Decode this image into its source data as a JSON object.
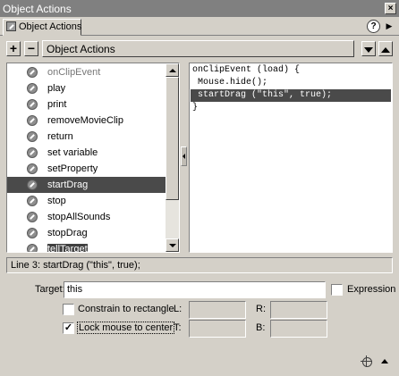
{
  "window": {
    "title": "Object Actions",
    "close_glyph": "×"
  },
  "tab": {
    "label": "Object Actions",
    "icon": "action-arrow-icon"
  },
  "header_buttons": {
    "help": "?",
    "menu": "▶"
  },
  "toolbar": {
    "add": "+",
    "remove": "−",
    "panel_title": "Object Actions"
  },
  "action_list": {
    "items": [
      {
        "label": "onClipEvent",
        "state": "dimmed"
      },
      {
        "label": "play",
        "state": "normal"
      },
      {
        "label": "print",
        "state": "normal"
      },
      {
        "label": "removeMovieClip",
        "state": "normal"
      },
      {
        "label": "return",
        "state": "normal"
      },
      {
        "label": "set variable",
        "state": "normal"
      },
      {
        "label": "setProperty",
        "state": "normal"
      },
      {
        "label": "startDrag",
        "state": "selected"
      },
      {
        "label": "stop",
        "state": "normal"
      },
      {
        "label": "stopAllSounds",
        "state": "normal"
      },
      {
        "label": "stopDrag",
        "state": "normal"
      },
      {
        "label": "tellTarget",
        "state": "partial"
      }
    ]
  },
  "code": {
    "lines": [
      {
        "text": "onClipEvent (load) {",
        "indent": 0,
        "selected": false
      },
      {
        "text": "Mouse.hide();",
        "indent": 1,
        "selected": false
      },
      {
        "text": "startDrag (\"this\", true);",
        "indent": 1,
        "selected": true
      },
      {
        "text": "}",
        "indent": 0,
        "selected": false
      }
    ]
  },
  "status": {
    "text": "Line 3: startDrag (\"this\", true);"
  },
  "params": {
    "target_label": "Target:",
    "target_value": "this",
    "expression_label": "Expression",
    "expression_checked": false,
    "constrain_label": "Constrain to rectangle",
    "constrain_checked": false,
    "lock_label": "Lock mouse to center",
    "lock_checked": true,
    "l_label": "L:",
    "r_label": "R:",
    "t_label": "T:",
    "b_label": "B:",
    "l_value": "",
    "r_value": "",
    "t_value": "",
    "b_value": ""
  },
  "footer": {
    "target_icon": "target-path-icon",
    "collapse_icon": "collapse-triangle-icon"
  },
  "colors": {
    "face": "#d4d0c8",
    "title_bar": "#808080",
    "selection": "#4a4a4a"
  }
}
